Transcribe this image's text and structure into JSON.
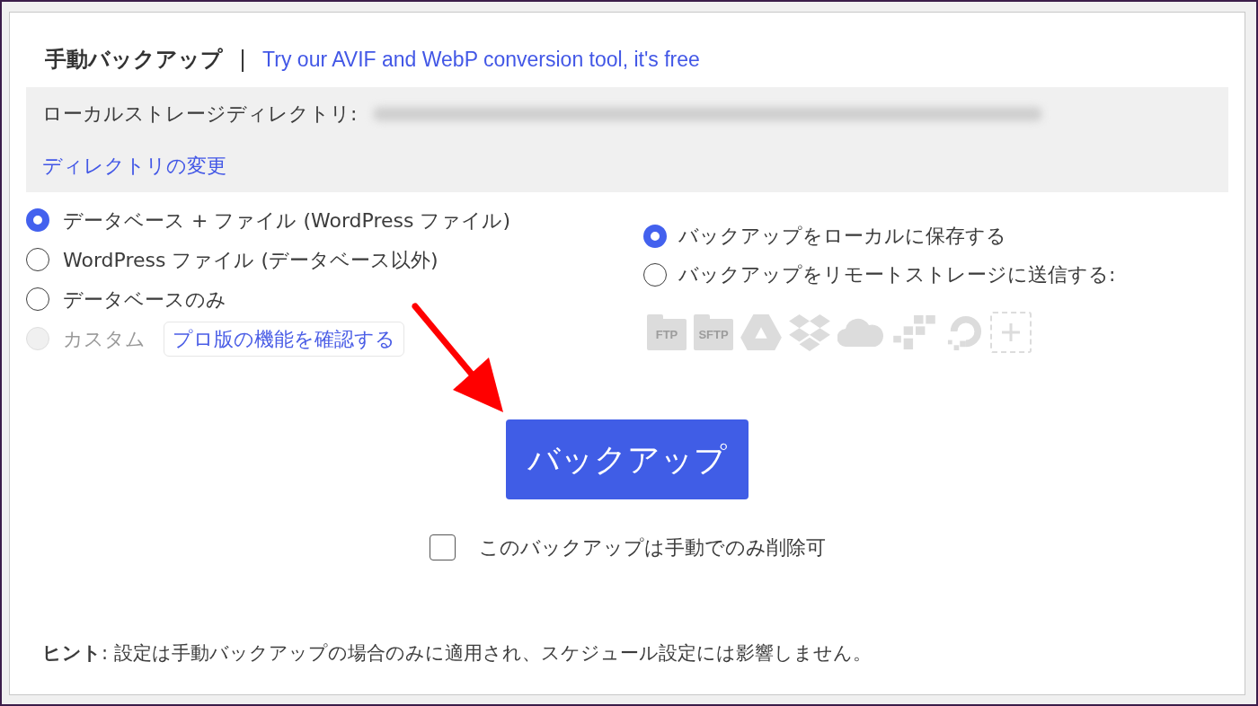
{
  "header": {
    "title": "手動バックアップ",
    "separator": "|",
    "promo_link": "Try our AVIF and WebP conversion tool, it's free"
  },
  "storage_directory": {
    "label": "ローカルストレージディレクトリ:",
    "change_link": "ディレクトリの変更"
  },
  "backup_contents": [
    {
      "label": "データベース + ファイル (WordPress ファイル)",
      "selected": true,
      "disabled": false
    },
    {
      "label": "WordPress ファイル (データベース以外)",
      "selected": false,
      "disabled": false
    },
    {
      "label": "データベースのみ",
      "selected": false,
      "disabled": false
    },
    {
      "label": "カスタム",
      "selected": false,
      "disabled": true,
      "pro_link": "プロ版の機能を確認する"
    }
  ],
  "destinations": [
    {
      "label": "バックアップをローカルに保存する",
      "selected": true
    },
    {
      "label": "バックアップをリモートストレージに送信する:",
      "selected": false
    }
  ],
  "remote_storage": [
    {
      "kind": "folder",
      "label": "FTP",
      "disabled": true
    },
    {
      "kind": "folder",
      "label": "SFTP",
      "disabled": true
    },
    {
      "kind": "triangle",
      "disabled": true
    },
    {
      "kind": "diamonds",
      "disabled": true
    },
    {
      "kind": "cloud",
      "disabled": true
    },
    {
      "kind": "cubes",
      "disabled": true
    },
    {
      "kind": "ring",
      "disabled": true
    },
    {
      "kind": "add",
      "disabled": true
    }
  ],
  "backup_button": "バックアップ",
  "manual_delete": {
    "label": "このバックアップは手動でのみ削除可",
    "checked": false
  },
  "hint": "**ヒント**: 設定は手動バックアップの場合のみに適用され、スケジュール設定には影響しません。"
}
